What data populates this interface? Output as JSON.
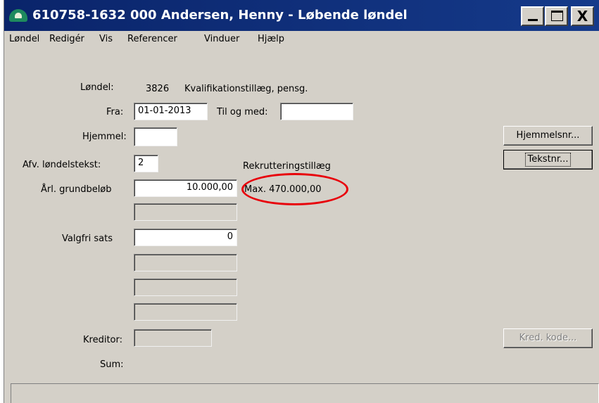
{
  "window": {
    "title": "610758-1632 000 Andersen, Henny - Løbende løndel",
    "app_icon": "app-logo-icon",
    "minimize_icon": "minimize-icon",
    "maximize_icon": "maximize-icon",
    "close_glyph": "X"
  },
  "menu": {
    "items": [
      "Løndel",
      "Redigér",
      "Vis",
      "Referencer",
      "Vinduer",
      "Hjælp"
    ]
  },
  "form": {
    "loendel_label": "Løndel:",
    "loendel_code": "3826",
    "loendel_name": "Kvalifikationstillæg, pensg.",
    "fra_label": "Fra:",
    "fra_value": "01-01-2013",
    "til_label": "Til og med:",
    "til_value": "",
    "hjemmel_label": "Hjemmel:",
    "hjemmel_value": "",
    "afv_label": "Afv. løndelstekst:",
    "afv_value": "2",
    "afv_text": "Rekrutteringstillæg",
    "grundbeloeb_label": "Årl. grundbeløb",
    "grundbeloeb_value": "10.000,00",
    "max_text": "Max. 470.000,00",
    "extra_field_1": "",
    "valgfri_label": "Valgfri sats",
    "valgfri_value": "0",
    "extra_field_2": "",
    "extra_field_3": "",
    "extra_field_4": "",
    "kreditor_label": "Kreditor:",
    "kreditor_value": "",
    "sum_label": "Sum:"
  },
  "buttons": {
    "hjemmelsnr": "Hjemmelsnr...",
    "tekstnr": "Tekstnr...",
    "kred_kode": "Kred. kode..."
  },
  "annotation": {
    "highlight_color": "#e8000a"
  },
  "status": {
    "text": ""
  }
}
